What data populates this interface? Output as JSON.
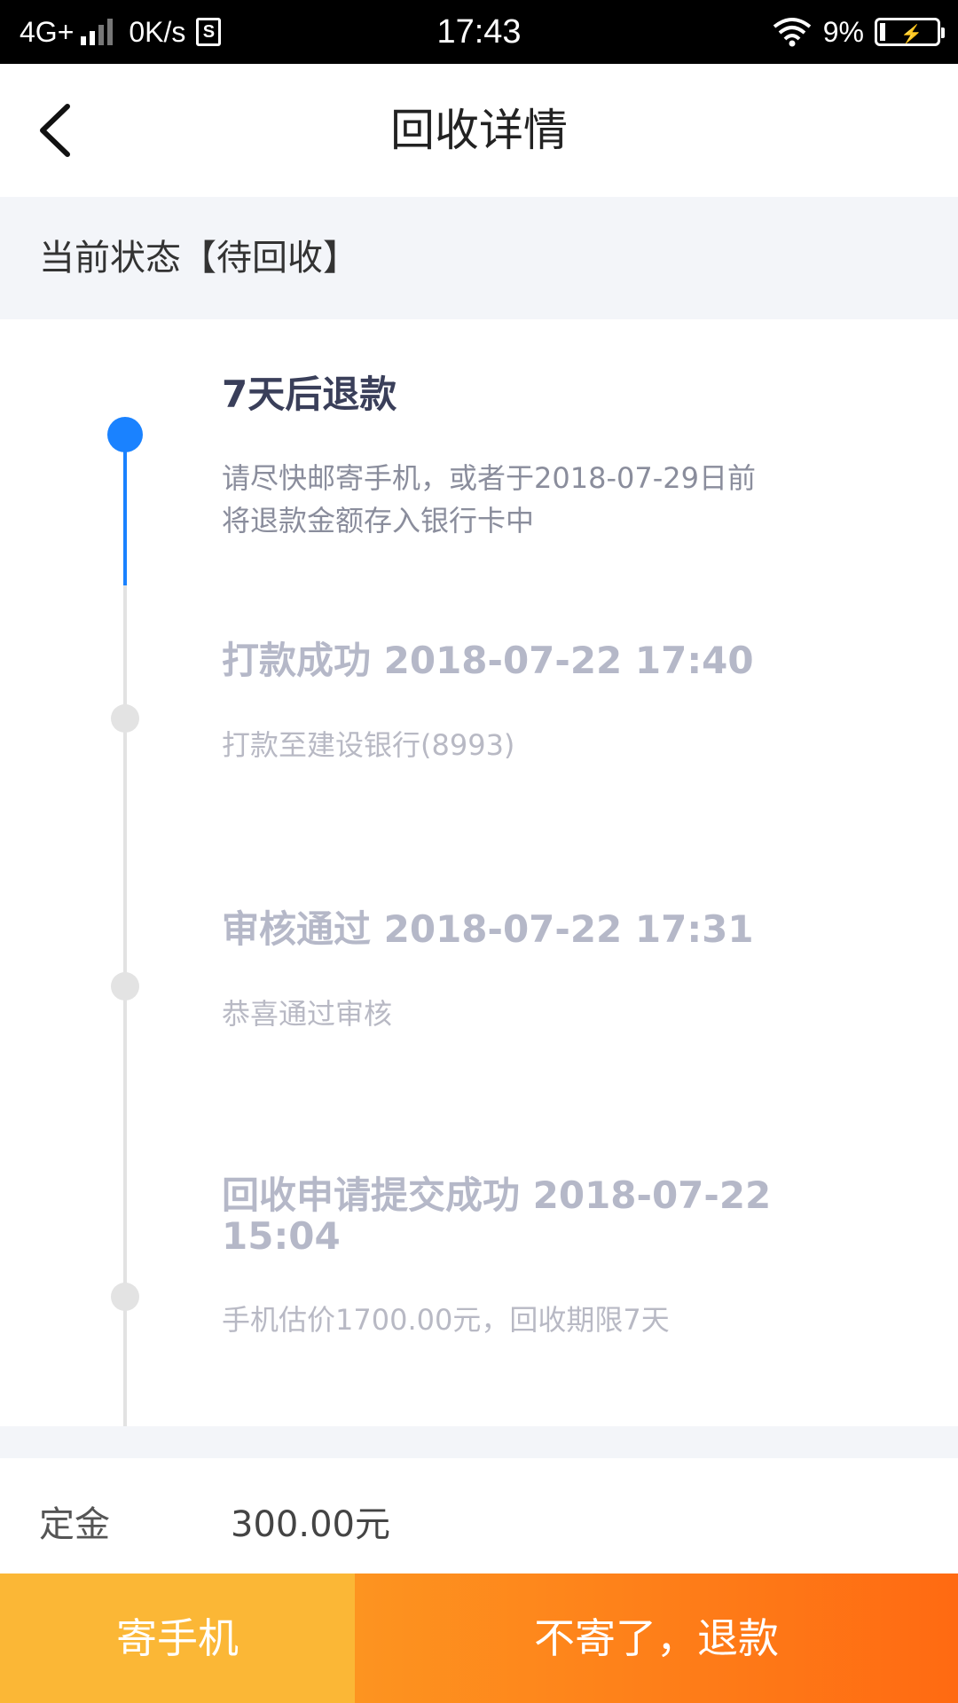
{
  "status_bar": {
    "network": "4G+",
    "speed": "0K/s",
    "sim_icon_text": "S",
    "time": "17:43",
    "battery": "9%"
  },
  "header": {
    "title": "回收详情",
    "back_icon": "chevron-left-icon"
  },
  "status": {
    "text": "当前状态【待回收】"
  },
  "timeline": [
    {
      "title": "7天后退款",
      "desc_line1": "请尽快邮寄手机，或者于2018-07-29日前",
      "desc_line2": "将退款金额存入银行卡中",
      "active": true
    },
    {
      "title": "打款成功 2018-07-22 17:40",
      "desc": "打款至建设银行(8993)",
      "active": false
    },
    {
      "title": "审核通过 2018-07-22 17:31",
      "desc": "恭喜通过审核",
      "active": false
    },
    {
      "title_line1": "回收申请提交成功 2018-07-22",
      "title_line2": "15:04",
      "desc": "手机估价1700.00元，回收期限7天",
      "active": false
    }
  ],
  "deposit": {
    "label": "定金",
    "value": "300.00元"
  },
  "actions": {
    "ship_label": "寄手机",
    "refund_label": "不寄了，退款"
  },
  "colors": {
    "accent_blue": "#1a82ff",
    "ship_orange": "#fbb736",
    "refund_orange": "#ff6a12"
  }
}
